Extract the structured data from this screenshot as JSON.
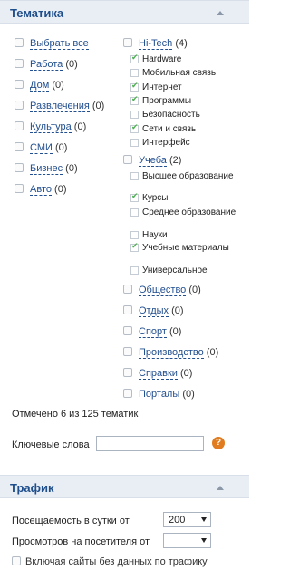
{
  "topics": {
    "title": "Тематика",
    "left_items": [
      {
        "label": "Выбрать все",
        "count": ""
      },
      {
        "label": "Работа",
        "count": "(0)"
      },
      {
        "label": "Дом",
        "count": "(0)"
      },
      {
        "label": "Развлечения",
        "count": "(0)"
      },
      {
        "label": "Культура",
        "count": "(0)"
      },
      {
        "label": "СМИ",
        "count": "(0)"
      },
      {
        "label": "Бизнес",
        "count": "(0)"
      },
      {
        "label": "Авто",
        "count": "(0)"
      }
    ],
    "hitech": {
      "label": "Hi-Tech",
      "count": "(4)",
      "sub": [
        {
          "label": "Hardware",
          "checked": true
        },
        {
          "label": "Мобильная связь",
          "checked": false
        },
        {
          "label": "Интернет",
          "checked": true
        },
        {
          "label": "Программы",
          "checked": true
        },
        {
          "label": "Безопасность",
          "checked": false
        },
        {
          "label": "Сети и связь",
          "checked": true
        },
        {
          "label": "Интерфейс",
          "checked": false
        }
      ]
    },
    "study": {
      "label": "Учеба",
      "count": "(2)",
      "sub": [
        {
          "label": "Высшее образование",
          "checked": false
        },
        {
          "label": "Курсы",
          "checked": true
        },
        {
          "label": "Среднее образование",
          "checked": false
        },
        {
          "label": "Науки",
          "checked": false
        },
        {
          "label": "Учебные материалы",
          "checked": true
        },
        {
          "label": "Универсальное",
          "checked": false
        }
      ]
    },
    "right_items": [
      {
        "label": "Общество",
        "count": "(0)"
      },
      {
        "label": "Отдых",
        "count": "(0)"
      },
      {
        "label": "Спорт",
        "count": "(0)"
      },
      {
        "label": "Производство",
        "count": "(0)"
      },
      {
        "label": "Справки",
        "count": "(0)"
      },
      {
        "label": "Порталы",
        "count": "(0)"
      }
    ],
    "status": "Отмечено 6 из 125 тематик",
    "keywords_label": "Ключевые слова",
    "help": "?"
  },
  "traffic": {
    "title": "Трафик",
    "visits_label": "Посещаемость в сутки от",
    "visits_value": "200",
    "views_label": "Просмотров на посетителя от",
    "views_value": "",
    "include_label": "Включая сайты без данных по трафику"
  }
}
